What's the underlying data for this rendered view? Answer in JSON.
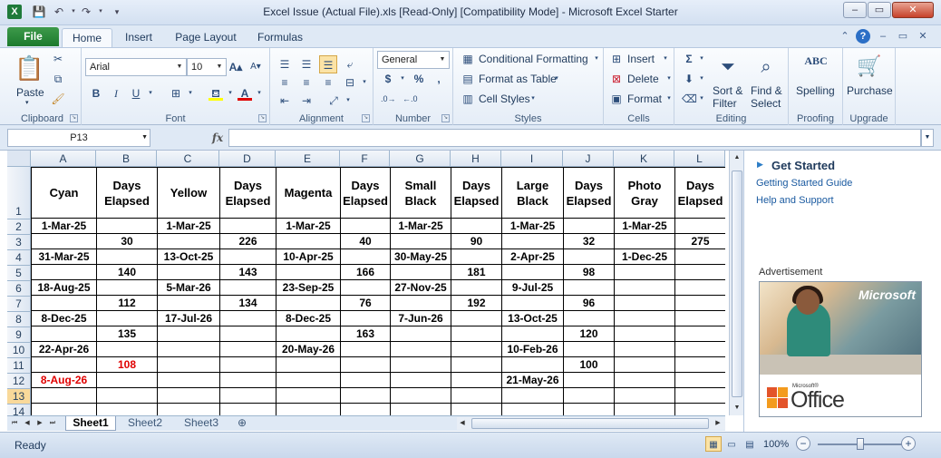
{
  "window": {
    "title": "Excel Issue (Actual File).xls  [Read-Only]  [Compatibility Mode]  -  Microsoft Excel Starter",
    "app_icon": "X",
    "controls": {
      "minimize": "–",
      "restore": "▭",
      "close": "✕"
    }
  },
  "quick_access": {
    "save_icon": "save-icon",
    "undo_icon": "undo-icon",
    "redo_icon": "redo-icon"
  },
  "tabs": {
    "file": "File",
    "home": "Home",
    "insert": "Insert",
    "page_layout": "Page Layout",
    "formulas": "Formulas"
  },
  "ribbon": {
    "clipboard": {
      "label": "Clipboard",
      "paste": "Paste"
    },
    "font": {
      "label": "Font",
      "name": "Arial",
      "size": "10",
      "bold": "B",
      "italic": "I",
      "underline": "U"
    },
    "alignment": {
      "label": "Alignment"
    },
    "number": {
      "label": "Number",
      "format": "General",
      "currency": "$",
      "percent": "%",
      "comma": ","
    },
    "styles": {
      "label": "Styles",
      "conditional": "Conditional Formatting",
      "format_table": "Format as Table",
      "cell_styles": "Cell Styles"
    },
    "cells": {
      "label": "Cells",
      "insert": "Insert",
      "delete": "Delete",
      "format": "Format"
    },
    "editing": {
      "label": "Editing",
      "sort": "Sort &",
      "filter": "Filter",
      "find": "Find &",
      "select": "Select"
    },
    "proofing": {
      "label": "Proofing",
      "spelling": "Spelling",
      "abc": "ABC"
    },
    "upgrade": {
      "label": "Upgrade",
      "purchase": "Purchase"
    }
  },
  "formula_bar": {
    "name_box": "P13",
    "fx": "fx",
    "value": ""
  },
  "columns": [
    "A",
    "B",
    "C",
    "D",
    "E",
    "F",
    "G",
    "H",
    "I",
    "J",
    "K",
    "L"
  ],
  "rows": [
    "1",
    "2",
    "3",
    "4",
    "5",
    "6",
    "7",
    "8",
    "9",
    "10",
    "11",
    "12",
    "13",
    "14"
  ],
  "selected_row": "13",
  "headers": [
    "Cyan",
    "Days Elapsed",
    "Yellow",
    "Days Elapsed",
    "Magenta",
    "Days Elapsed",
    "Small Black",
    "Days Elapsed",
    "Large Black",
    "Days Elapsed",
    "Photo Gray",
    "Days Elapsed"
  ],
  "cells": [
    [
      "1-Mar-25",
      "",
      "1-Mar-25",
      "",
      "1-Mar-25",
      "",
      "1-Mar-25",
      "",
      "1-Mar-25",
      "",
      "1-Mar-25",
      ""
    ],
    [
      "",
      "30",
      "",
      "226",
      "",
      "40",
      "",
      "90",
      "",
      "32",
      "",
      "275"
    ],
    [
      "31-Mar-25",
      "",
      "13-Oct-25",
      "",
      "10-Apr-25",
      "",
      "30-May-25",
      "",
      "2-Apr-25",
      "",
      "1-Dec-25",
      ""
    ],
    [
      "",
      "140",
      "",
      "143",
      "",
      "166",
      "",
      "181",
      "",
      "98",
      "",
      ""
    ],
    [
      "18-Aug-25",
      "",
      "5-Mar-26",
      "",
      "23-Sep-25",
      "",
      "27-Nov-25",
      "",
      "9-Jul-25",
      "",
      "",
      ""
    ],
    [
      "",
      "112",
      "",
      "134",
      "",
      "76",
      "",
      "192",
      "",
      "96",
      "",
      ""
    ],
    [
      "8-Dec-25",
      "",
      "17-Jul-26",
      "",
      "8-Dec-25",
      "",
      "7-Jun-26",
      "",
      "13-Oct-25",
      "",
      "",
      ""
    ],
    [
      "",
      "135",
      "",
      "",
      "",
      "163",
      "",
      "",
      "",
      "120",
      "",
      ""
    ],
    [
      "22-Apr-26",
      "",
      "",
      "",
      "20-May-26",
      "",
      "",
      "",
      "10-Feb-26",
      "",
      "",
      ""
    ],
    [
      "",
      "108",
      "",
      "",
      "",
      "",
      "",
      "",
      "",
      "100",
      "",
      ""
    ],
    [
      "8-Aug-26",
      "",
      "",
      "",
      "",
      "",
      "",
      "",
      "21-May-26",
      "",
      "",
      ""
    ],
    [
      "",
      "",
      "",
      "",
      "",
      "",
      "",
      "",
      "",
      "",
      "",
      ""
    ],
    [
      "",
      "",
      "",
      "",
      "",
      "",
      "",
      "",
      "",
      "",
      "",
      ""
    ]
  ],
  "red_cells": [
    "11-B",
    "12-A"
  ],
  "sheets": [
    "Sheet1",
    "Sheet2",
    "Sheet3"
  ],
  "active_sheet": "Sheet1",
  "taskpane": {
    "title": "Get Started",
    "links": [
      "Getting Started Guide",
      "Help and Support"
    ],
    "ad_label": "Advertisement",
    "ad_brand": "Microsoft",
    "ad_small": "Microsoft®",
    "ad_product": "Office"
  },
  "status": {
    "text": "Ready",
    "zoom": "100%",
    "zoom_level_pct": 50
  },
  "colors": {
    "accent_green": "#1c7a2e",
    "selected_row": "#f9d99a",
    "error_red": "#e00000"
  }
}
